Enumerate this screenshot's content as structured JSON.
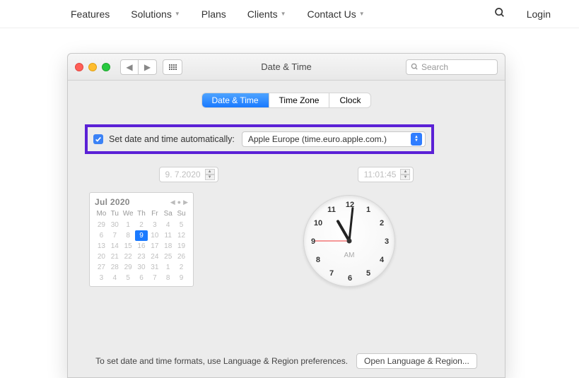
{
  "topnav": {
    "items": [
      "Features",
      "Solutions",
      "Plans",
      "Clients",
      "Contact Us"
    ],
    "login": "Login"
  },
  "window": {
    "title": "Date & Time",
    "search_placeholder": "Search",
    "tabs": [
      "Date & Time",
      "Time Zone",
      "Clock"
    ],
    "active_tab": 0,
    "auto_checkbox_label": "Set date and time automatically:",
    "auto_checked": true,
    "server_value": "Apple Europe (time.euro.apple.com.)",
    "date_input": "9.  7.2020",
    "time_input": "11:01:45",
    "calendar": {
      "title": "Jul 2020",
      "dow": [
        "Mo",
        "Tu",
        "We",
        "Th",
        "Fr",
        "Sa",
        "Su"
      ],
      "days": [
        [
          29,
          30,
          1,
          2,
          3,
          4,
          5
        ],
        [
          6,
          7,
          8,
          9,
          10,
          11,
          12
        ],
        [
          13,
          14,
          15,
          16,
          17,
          18,
          19
        ],
        [
          20,
          21,
          22,
          23,
          24,
          25,
          26
        ],
        [
          27,
          28,
          29,
          30,
          31,
          1,
          2
        ],
        [
          3,
          4,
          5,
          6,
          7,
          8,
          9
        ]
      ],
      "selected": 9
    },
    "clock": {
      "ampm": "AM",
      "hour_angle": 330,
      "min_angle": 6,
      "sec_angle": 270
    },
    "footer_text": "To set date and time formats, use Language & Region preferences.",
    "footer_button": "Open Language & Region..."
  }
}
